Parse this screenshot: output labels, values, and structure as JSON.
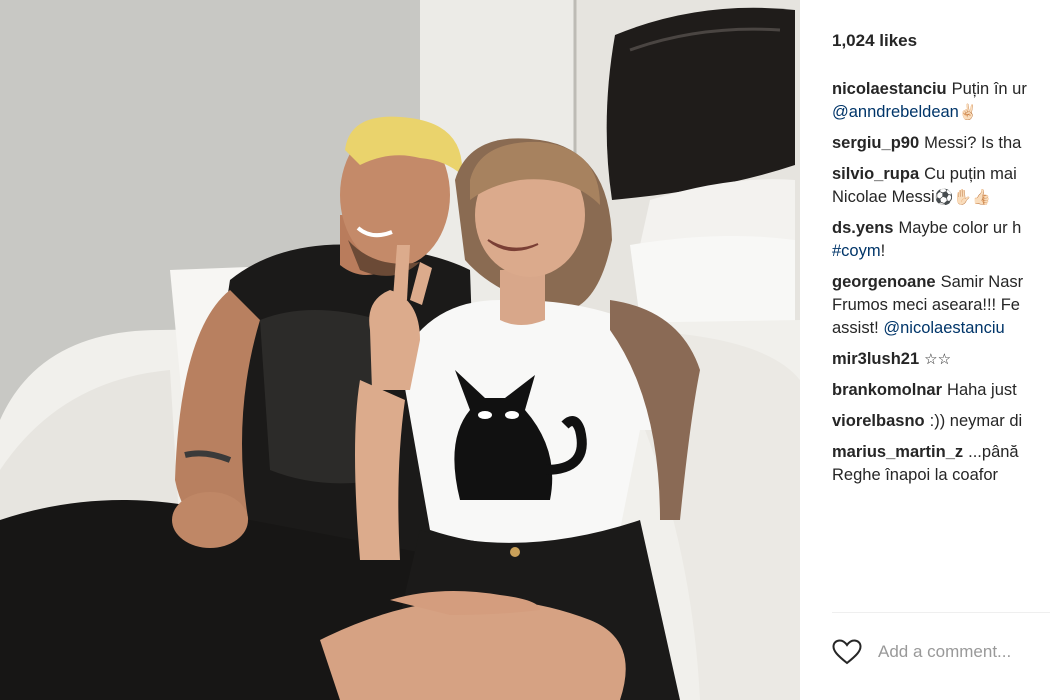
{
  "post": {
    "likes": "1,024 likes",
    "comments": [
      {
        "user": "nicolaestanciu",
        "lines": [
          [
            {
              "t": "text",
              "v": "Puțin în ur"
            }
          ],
          [
            {
              "t": "mention",
              "v": "@anndrebeldean"
            },
            {
              "t": "emoji",
              "v": "✌🏻"
            }
          ]
        ]
      },
      {
        "user": "sergiu_p90",
        "lines": [
          [
            {
              "t": "text",
              "v": "Messi? Is tha"
            }
          ]
        ]
      },
      {
        "user": "silvio_rupa",
        "lines": [
          [
            {
              "t": "text",
              "v": "Cu puțin mai"
            }
          ],
          [
            {
              "t": "text",
              "v": "Nicolae Messi"
            },
            {
              "t": "emoji",
              "v": "⚽✋🏻👍🏻"
            }
          ]
        ]
      },
      {
        "user": "ds.yens",
        "lines": [
          [
            {
              "t": "text",
              "v": "Maybe color ur h"
            }
          ],
          [
            {
              "t": "tag",
              "v": "#coym"
            },
            {
              "t": "text",
              "v": "!"
            }
          ]
        ]
      },
      {
        "user": "georgenoane",
        "lines": [
          [
            {
              "t": "text",
              "v": "Samir Nasr"
            }
          ],
          [
            {
              "t": "text",
              "v": "Frumos meci aseara!!! Fe"
            }
          ],
          [
            {
              "t": "text",
              "v": "assist! "
            },
            {
              "t": "mention",
              "v": "@nicolaestanciu"
            }
          ]
        ]
      },
      {
        "user": "mir3lush21",
        "lines": [
          [
            {
              "t": "emoji",
              "v": "☆☆"
            }
          ]
        ]
      },
      {
        "user": "brankomolnar",
        "lines": [
          [
            {
              "t": "text",
              "v": "Haha just"
            }
          ]
        ]
      },
      {
        "user": "viorelbasno",
        "lines": [
          [
            {
              "t": "text",
              "v": ":)) neymar di"
            }
          ]
        ]
      },
      {
        "user": "marius_martin_z",
        "lines": [
          [
            {
              "t": "text",
              "v": "...până"
            }
          ],
          [
            {
              "t": "text",
              "v": "Reghe înapoi la coafor"
            }
          ]
        ]
      }
    ],
    "add_comment_placeholder": "Add a comment...",
    "icons": {
      "like": "heart-icon"
    }
  }
}
